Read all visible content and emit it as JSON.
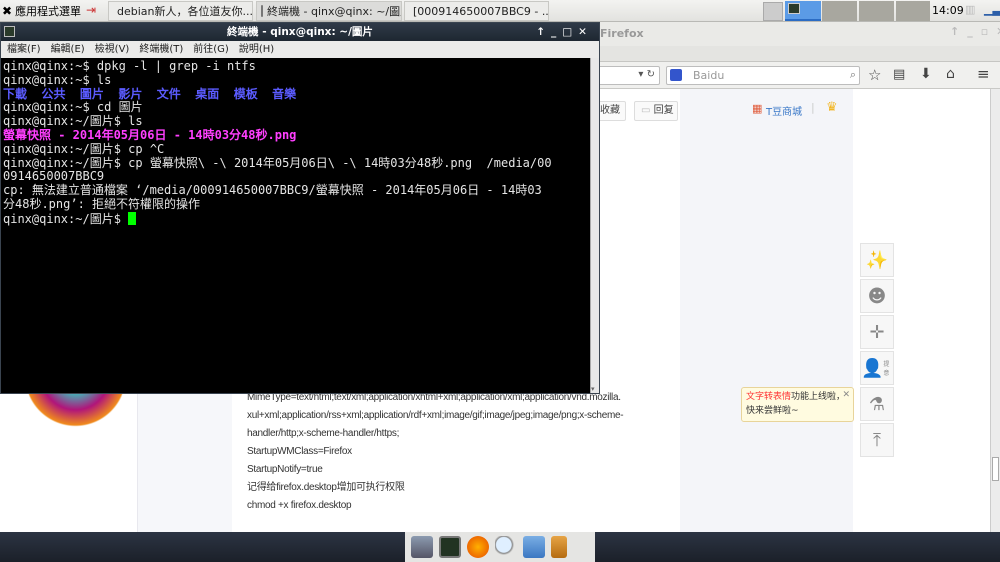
{
  "panel": {
    "app_menu": "應用程式選單",
    "tasks": [
      "debian新人，各位道友你...",
      "終端機 - qinx@qinx: ~/圖片",
      "[000914650007BBC9 - ..."
    ],
    "clock": "14:09"
  },
  "firefox": {
    "title": "Firefox",
    "search_placeholder": "Baidu",
    "buttons": {
      "collect": "收藏",
      "reply": "回复"
    },
    "shop": "T豆商城",
    "article": [
      "MimeType=text/html;text/xml;application/xhtml+xml;application/xml;application/vnd.mozilla.",
      "xul+xml;application/rss+xml;application/rdf+xml;image/gif;image/jpeg;image/png;x-scheme-",
      "handler/http;x-scheme-handler/https;",
      "StartupWMClass=Firefox",
      "StartupNotify=true",
      "记得给firefox.desktop增加可执行权限",
      "chmod +x firefox.desktop"
    ],
    "tooltip": {
      "highlight": "文字转表情",
      "text": "功能上线啦，快来尝鲜啦~"
    },
    "side_label": "提意"
  },
  "terminal": {
    "title": "終端機 - qinx@qinx: ~/圖片",
    "menu": [
      "檔案(F)",
      "編輯(E)",
      "檢視(V)",
      "終端機(T)",
      "前往(G)",
      "說明(H)"
    ],
    "lines": [
      {
        "text": "qinx@qinx:~$ dpkg -l | grep -i ntfs",
        "style": ""
      },
      {
        "text": "qinx@qinx:~$ ls",
        "style": ""
      },
      {
        "text": "下載  公共  圖片  影片  文件  桌面  模板  音樂",
        "style": "blue"
      },
      {
        "text": "qinx@qinx:~$ cd 圖片",
        "style": ""
      },
      {
        "text": "qinx@qinx:~/圖片$ ls",
        "style": ""
      },
      {
        "text": "螢幕快照 - 2014年05月06日 - 14時03分48秒.png",
        "style": "mag"
      },
      {
        "text": "qinx@qinx:~/圖片$ cp ^C",
        "style": ""
      },
      {
        "text": "qinx@qinx:~/圖片$ cp 螢幕快照\\ -\\ 2014年05月06日\\ -\\ 14時03分48秒.png  /media/00",
        "style": ""
      },
      {
        "text": "0914650007BBC9",
        "style": ""
      },
      {
        "text": "cp: 無法建立普通檔案 ‘/media/000914650007BBC9/螢幕快照 - 2014年05月06日 - 14時03",
        "style": ""
      },
      {
        "text": "分48秒.png’: 拒絕不符權限的操作",
        "style": ""
      },
      {
        "text": "qinx@qinx:~/圖片$ ",
        "style": "prompt"
      }
    ]
  }
}
